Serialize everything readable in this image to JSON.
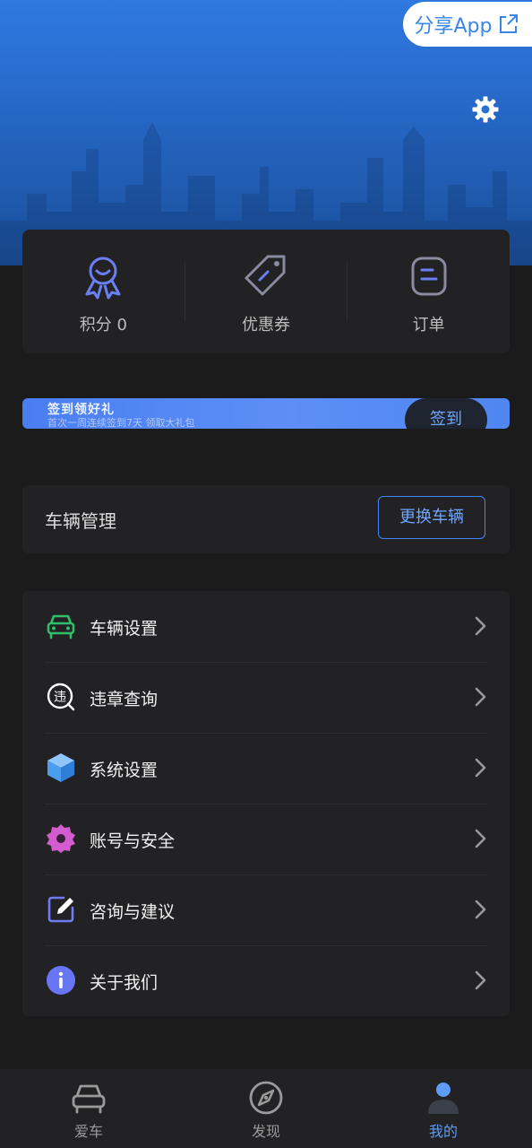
{
  "header": {
    "share_label": "分享App"
  },
  "stats": [
    {
      "label": "积分 0",
      "icon": "award-ribbon-icon"
    },
    {
      "label": "优惠券",
      "icon": "coupon-tag-icon"
    },
    {
      "label": "订单",
      "icon": "order-icon"
    }
  ],
  "banner": {
    "title": "签到领好礼",
    "subtitle": "首次一周连续签到7天 领取大礼包",
    "button_label": "签到"
  },
  "vehicle": {
    "title": "车辆管理",
    "change_label": "更换车辆"
  },
  "menu": [
    {
      "label": "车辆设置",
      "icon": "car-icon",
      "color": "#2fbf6a"
    },
    {
      "label": "违章查询",
      "icon": "violation-search-icon",
      "color": "#ffffff"
    },
    {
      "label": "系统设置",
      "icon": "cube-icon",
      "color": "#4a9df0"
    },
    {
      "label": "账号与安全",
      "icon": "gear-badge-icon",
      "color": "#d35ccf"
    },
    {
      "label": "咨询与建议",
      "icon": "edit-icon",
      "color": "#6d7cf0"
    },
    {
      "label": "关于我们",
      "icon": "info-icon",
      "color": "#6875f5"
    }
  ],
  "violation_glyph": "违",
  "tabs": [
    {
      "label": "爱车",
      "icon": "car-outline-icon",
      "active": false
    },
    {
      "label": "发现",
      "icon": "compass-icon",
      "active": false
    },
    {
      "label": "我的",
      "icon": "profile-icon",
      "active": true
    }
  ],
  "colors": {
    "accent": "#3c86f5",
    "hero_top": "#2f79e1",
    "background": "#1b1b1c",
    "card": "#222224"
  }
}
